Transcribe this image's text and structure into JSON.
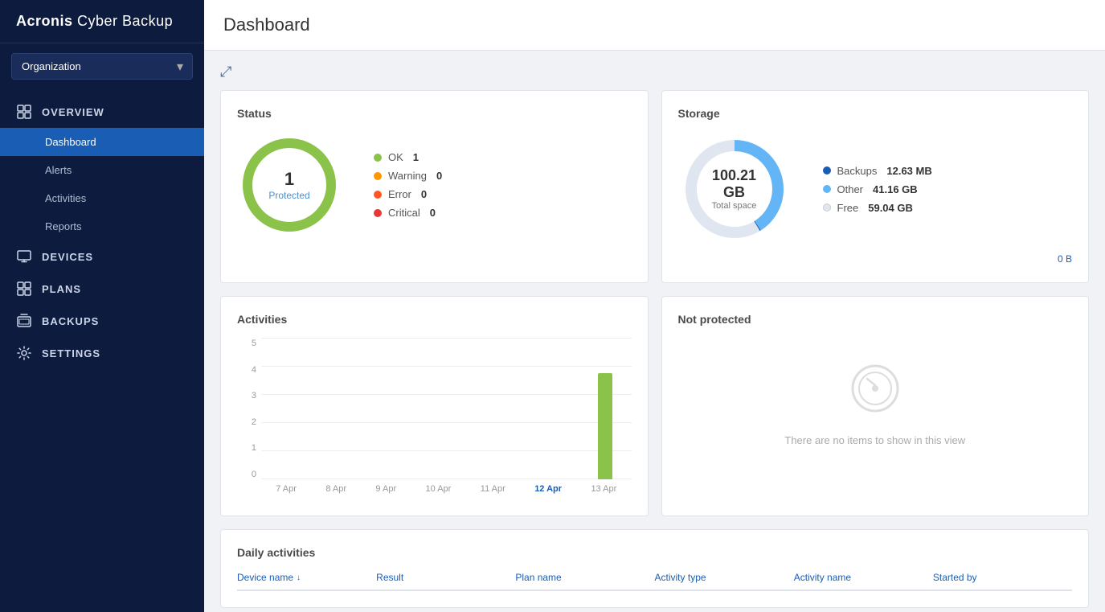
{
  "app": {
    "brand": "Acronis",
    "product": " Cyber Backup"
  },
  "sidebar": {
    "org_label": "Organization",
    "nav": [
      {
        "id": "overview",
        "label": "OVERVIEW",
        "icon": "grid-icon",
        "children": [
          {
            "id": "dashboard",
            "label": "Dashboard",
            "active": true
          },
          {
            "id": "alerts",
            "label": "Alerts",
            "active": false
          },
          {
            "id": "activities",
            "label": "Activities",
            "active": false
          },
          {
            "id": "reports",
            "label": "Reports",
            "active": false
          }
        ]
      },
      {
        "id": "devices",
        "label": "DEVICES",
        "icon": "monitor-icon",
        "children": []
      },
      {
        "id": "plans",
        "label": "PLANS",
        "icon": "plans-icon",
        "children": []
      },
      {
        "id": "backups",
        "label": "BACKUPS",
        "icon": "backups-icon",
        "children": []
      },
      {
        "id": "settings",
        "label": "SETTINGS",
        "icon": "gear-icon",
        "children": []
      }
    ]
  },
  "main": {
    "title": "Dashboard",
    "expand_title": "Expand"
  },
  "status_card": {
    "title": "Status",
    "center_num": "1",
    "center_label": "Protected",
    "legend": [
      {
        "label": "OK",
        "value": "1",
        "color": "#8bc34a"
      },
      {
        "label": "Warning",
        "value": "0",
        "color": "#ff9800"
      },
      {
        "label": "Error",
        "value": "0",
        "color": "#ff5722"
      },
      {
        "label": "Critical",
        "value": "0",
        "color": "#e53935"
      }
    ]
  },
  "storage_card": {
    "title": "Storage",
    "center_size": "100.21 GB",
    "center_label": "Total space",
    "legend": [
      {
        "label": "Backups",
        "value": "12.63 MB",
        "color": "#1a5db5"
      },
      {
        "label": "Other",
        "value": "41.16 GB",
        "color": "#64b5f6"
      },
      {
        "label": "Free",
        "value": "59.04 GB",
        "color": "#e0e6f0"
      }
    ],
    "link_label": "0 B"
  },
  "activities_card": {
    "title": "Activities",
    "y_labels": [
      "0",
      "1",
      "2",
      "3",
      "4",
      "5"
    ],
    "x_labels": [
      {
        "label": "7 Apr",
        "highlight": false
      },
      {
        "label": "8 Apr",
        "highlight": false
      },
      {
        "label": "9 Apr",
        "highlight": false
      },
      {
        "label": "10 Apr",
        "highlight": false
      },
      {
        "label": "11 Apr",
        "highlight": false
      },
      {
        "label": "12 Apr",
        "highlight": true
      },
      {
        "label": "13 Apr",
        "highlight": false
      }
    ],
    "bars": [
      0,
      0,
      0,
      0,
      0,
      0,
      4
    ]
  },
  "not_protected_card": {
    "title": "Not protected",
    "empty_text": "There are no items to show in this view"
  },
  "daily_activities_card": {
    "title": "Daily activities",
    "columns": [
      {
        "label": "Device name",
        "sortable": true
      },
      {
        "label": "Result",
        "sortable": false
      },
      {
        "label": "Plan name",
        "sortable": false
      },
      {
        "label": "Activity type",
        "sortable": false
      },
      {
        "label": "Activity name",
        "sortable": false
      },
      {
        "label": "Started by",
        "sortable": false
      }
    ]
  }
}
